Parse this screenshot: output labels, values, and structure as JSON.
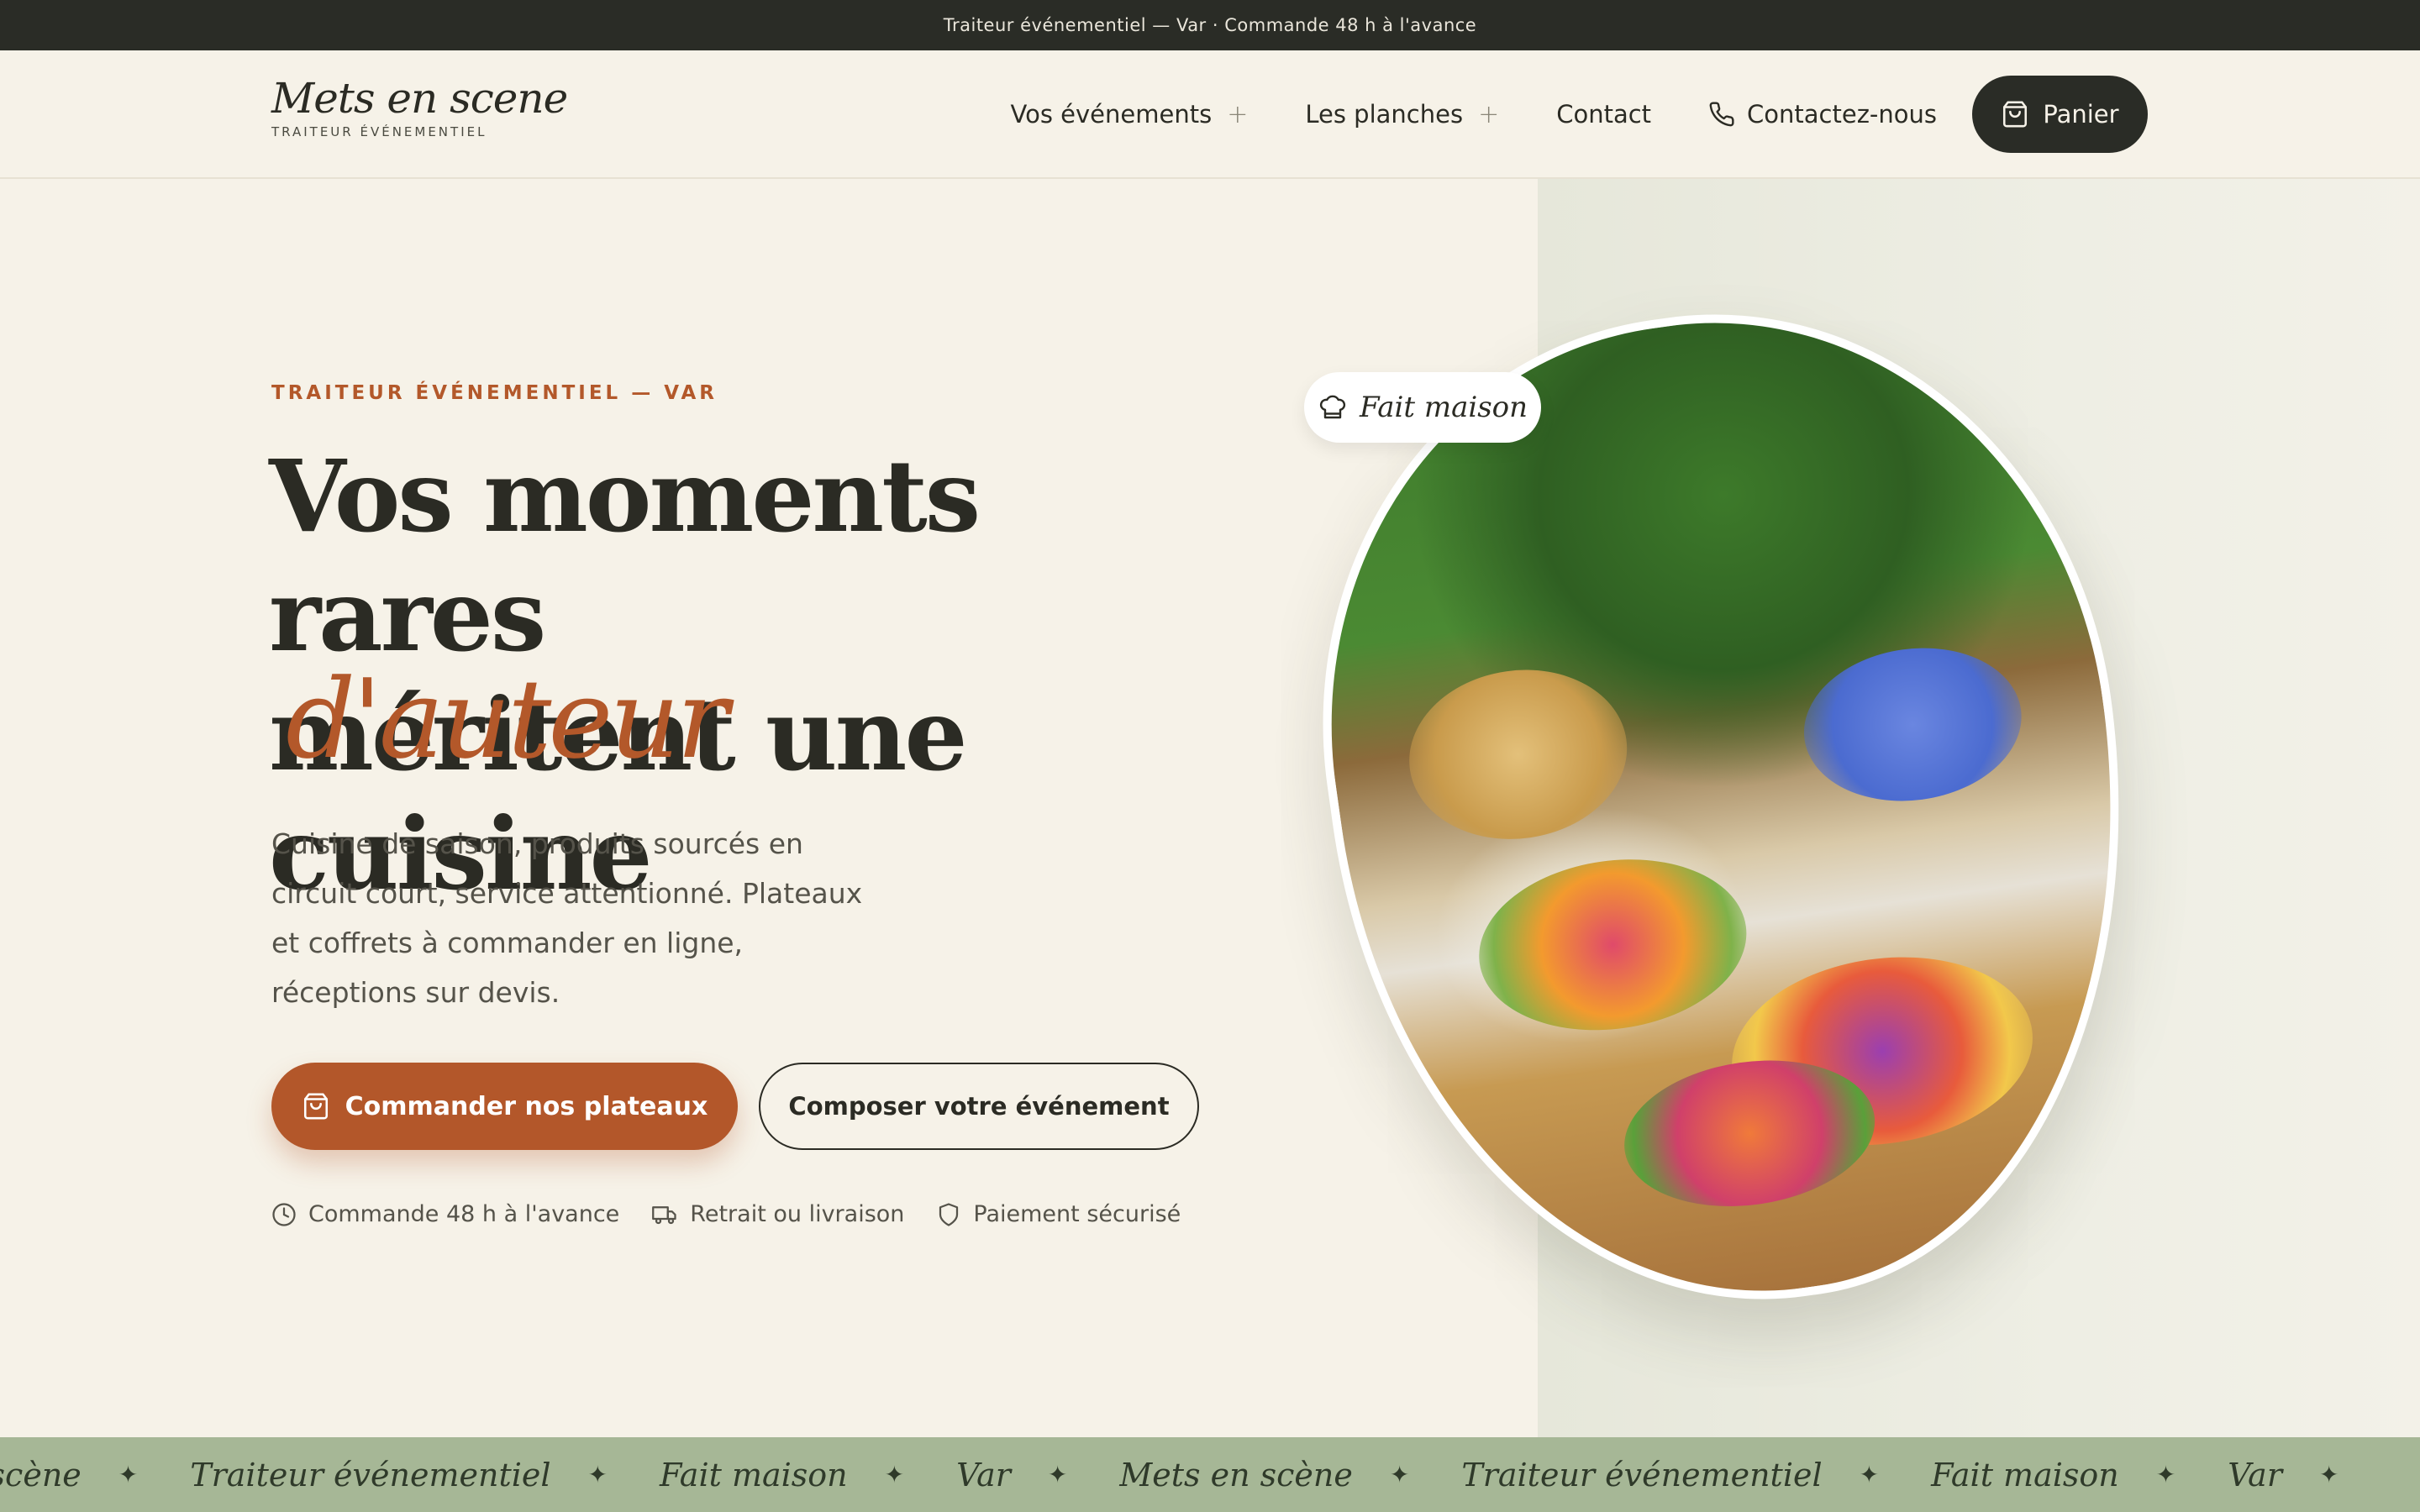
{
  "topbar": {
    "text": "Traiteur événementiel — Var · Commande 48 h à l'avance"
  },
  "header": {
    "logo_script": "Mets en scene",
    "logo_sub": "TRAITEUR ÉVÉNEMENTIEL",
    "nav": [
      {
        "label": "Vos événements",
        "expandable": true
      },
      {
        "label": "Les planches",
        "expandable": true
      },
      {
        "label": "Contact",
        "expandable": false
      }
    ],
    "phone_label": "Contactez-nous",
    "cart_label": "Panier"
  },
  "hero": {
    "eyebrow": "TRAITEUR ÉVÉNEMENTIEL — VAR",
    "headline_line1": "Vos moments rares",
    "headline_line2": "méritent une cuisine",
    "headline_accent": "d'auteur",
    "description": "Cuisine de saison, produits sourcés en circuit court, service attentionné. Plateaux et coffrets à commander en ligne, réceptions sur devis.",
    "cta_primary": "Commander nos plateaux",
    "cta_secondary": "Composer votre événement",
    "features": [
      {
        "icon": "clock-icon",
        "label": "Commande 48 h à l'avance"
      },
      {
        "icon": "truck-icon",
        "label": "Retrait ou livraison"
      },
      {
        "icon": "shield-icon",
        "label": "Paiement sécurisé"
      }
    ],
    "badge": "Fait maison"
  },
  "marquee": {
    "items": [
      "n scène",
      "Traiteur événementiel",
      "Fait maison",
      "Var",
      "Mets en scène",
      "Traiteur événementiel",
      "Fait maison",
      "Var"
    ]
  },
  "colors": {
    "accent": "#b3572a",
    "dark": "#2a2c26",
    "background": "#f6f2e8",
    "marquee": "#a6b796"
  }
}
